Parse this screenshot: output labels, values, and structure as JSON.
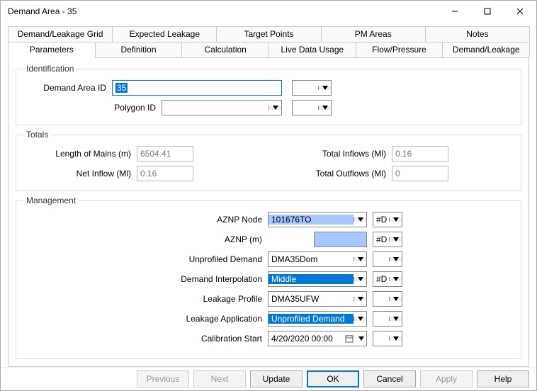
{
  "window": {
    "title": "Demand Area - 35"
  },
  "tabs": {
    "row1": [
      "Demand/Leakage Grid",
      "Expected Leakage",
      "Target Points",
      "PM Areas",
      "Notes"
    ],
    "row2": [
      "Parameters",
      "Definition",
      "Calculation",
      "Live Data Usage",
      "Flow/Pressure",
      "Demand/Leakage"
    ],
    "active": "Parameters"
  },
  "identification": {
    "legend": "Identification",
    "demand_area_id_label": "Demand Area ID",
    "demand_area_id_value": "35",
    "polygon_id_label": "Polygon ID",
    "polygon_id_value": ""
  },
  "totals": {
    "legend": "Totals",
    "length_label": "Length of Mains (m)",
    "length_value": "6504.41",
    "net_inflow_label": "Net Inflow (Ml)",
    "net_inflow_value": "0.16",
    "total_inflows_label": "Total Inflows (Ml)",
    "total_inflows_value": "0.16",
    "total_outflows_label": "Total Outflows (Ml)",
    "total_outflows_value": "0"
  },
  "management": {
    "legend": "Management",
    "aznp_node_label": "AZNP Node",
    "aznp_node_value": "101676TO",
    "aznp_node_side": "#D",
    "aznp_m_label": "AZNP (m)",
    "aznp_m_value": "",
    "aznp_m_side": "#D",
    "unprofiled_demand_label": "Unprofiled Demand",
    "unprofiled_demand_value": "DMA35Dom",
    "unprofiled_demand_side": "",
    "demand_interp_label": "Demand Interpolation",
    "demand_interp_value": "Middle",
    "demand_interp_side": "#D",
    "leakage_profile_label": "Leakage Profile",
    "leakage_profile_value": "DMA35UFW",
    "leakage_profile_side": "",
    "leakage_app_label": "Leakage Application",
    "leakage_app_value": "Unprofiled Demand",
    "leakage_app_side": "",
    "calibration_start_label": "Calibration Start",
    "calibration_start_value": "4/20/2020 00:00",
    "calibration_start_side": ""
  },
  "footer": {
    "previous": "Previous",
    "next": "Next",
    "update": "Update",
    "ok": "OK",
    "cancel": "Cancel",
    "apply": "Apply",
    "help": "Help"
  }
}
